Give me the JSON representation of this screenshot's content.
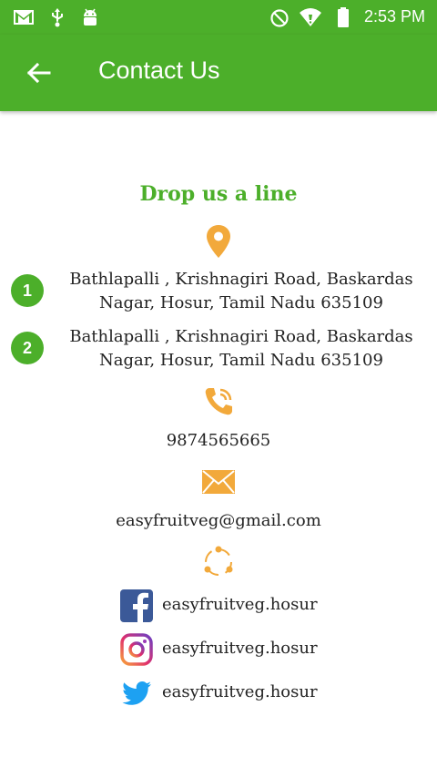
{
  "status_bar": {
    "time": "2:53 PM"
  },
  "app_bar": {
    "title": "Contact Us"
  },
  "content": {
    "heading": "Drop us a line",
    "addresses": [
      {
        "number": "1",
        "line1": "Bathlapalli , Krishnagiri Road, Baskardas",
        "line2": "Nagar, Hosur, Tamil Nadu 635109"
      },
      {
        "number": "2",
        "line1": "Bathlapalli , Krishnagiri Road, Baskardas",
        "line2": "Nagar, Hosur, Tamil Nadu 635109"
      }
    ],
    "phone": "9874565665",
    "email": "easyfruitveg@gmail.com",
    "social": {
      "facebook": "easyfruitveg.hosur",
      "instagram": "easyfruitveg.hosur",
      "twitter": "easyfruitveg.hosur"
    }
  },
  "colors": {
    "primary": "#4caf2a",
    "accent_icon": "#f2a93b",
    "text": "#222222"
  }
}
